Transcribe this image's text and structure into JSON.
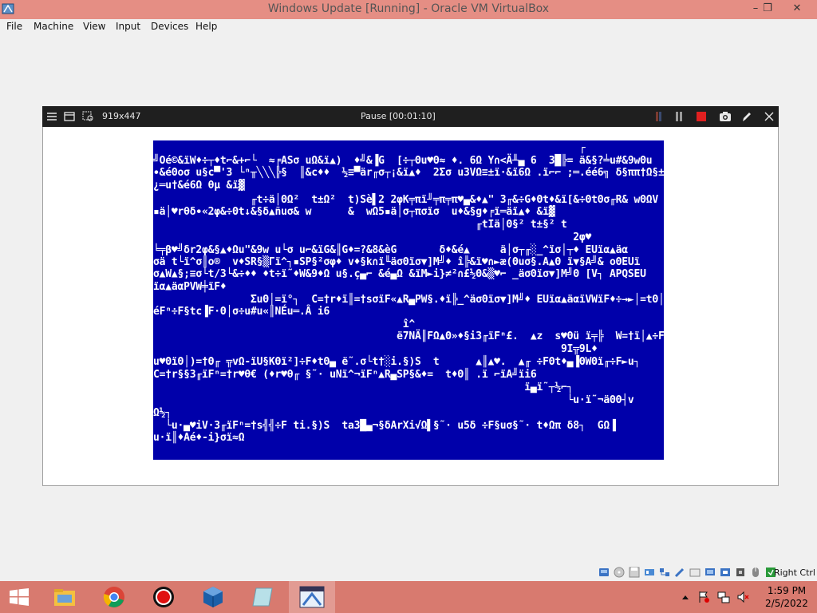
{
  "window": {
    "title": "Windows Update [Running] - Oracle VM VirtualBox",
    "minimize": "–",
    "restore": "❐",
    "close": "✕"
  },
  "menu": {
    "items": [
      "File",
      "Machine",
      "View",
      "Input",
      "Devices",
      "Help"
    ]
  },
  "capture_toolbar": {
    "dimensions": "919x447",
    "status": "Pause [00:01:10]"
  },
  "guest_screen": {
    "lines": [
      "                                                                      ┌",
      "╝Oé©&ïW♦÷┬♦t⌐&+⌐└  ≈╒ASσ uΩ&ï▲)  ♦╝&▐G  [÷┬Θu♥Θ≈ ♦. 6Ω Y∩<Ä╨▄ 6  3█╠= ä&§?╧u#&9wΘu",
      "∙&éΘoσ u§c▀'3 └ⁿ╥╲╲╲╠§  ║&c♦♦  ½≡▀är╓σ┬¡&ï▲♦  2Σσ u3VΩ≡±ï·&ï6Ω .ï⌐⌐ ;═.éé6╗ δ§ππ†Ω§±&ï⌐Ω",
      "¿═u†&é6Ω θµ &ï▓",
      "                ╓t÷ä│ΘΩ²  t±Ω²  t)Sè▌2 2φK╤πï╜╤π╤π♥▄&♦▲\" 3╓&÷G♦Θt♦&ï[&÷ΘtΘσ╓R& wΘΩV",
      "▪ä│♥rθδ∙«2φ&÷Θt↓&§δ▲ñuσ& w      &  wΩ5▪ä│σ┬πσïσ  u♦&§g♦╒ï═äï▲♦ &ï▓",
      "                                                     ╓tIä│Θ§² t±§² t",
      "                                                                     2φ♥",
      "╘╤β♥╝δr2φ&§▲♦Ωu\"&9w u└σ u⌐&ïG&║G♦=?&8&èG       δ♦&é▲     ä│σ┬╓░_^ïσ│┬♦ EUïα▲äα",
      "σä t└ï^σ║ο®  v♦SR§▒Γï^┐▪SP§²σφ♦ v♦§k∩ï╙äσΘïσ▼]M╝♦ î╠&ï♥∩►æ(Θuσ§.A▲Θ ï▼§A╝& oΘEUï",
      "σ▲W▲§;≡σ└t/3└&÷♦♦ ♦t÷ï˜♦W&9♦Ω u§.ç▄⌐ &é▄Ω &ïM►i}≠²∩£½Θ&▒♥⌐ _äσΘïσ▼]M╝Θ [V┐ APQSEU",
      "ïα▲äαPVW╪ïF♦",
      "                ΣuΘ│=ï°┐  C=†r♦ï║=†sσïF«▲R▄PW§.♦ï╠_^äσΘïσ▼]M╝♦ EUïα▲äαïVWïF♦÷→►│=tΘ│(",
      "éFⁿ÷F§tc▐F·Θ│σ÷u#u«║NÉu═.Â i6",
      "                                         î^",
      "                                        ë7NÄ║FΩ▲Θ»♦§i3╓ïFⁿ£.  ▲z  s♥Θü ï╤╠  W=†ï│▲÷F♦t",
      "                                                                   9I╦9L♦",
      "u♥ΘïΘ│)=†Θ╓ ╦vΩ-ïU§KΘï²]÷F♦tΘ▄ ë˜.σ└t†░i.§)S  t      ▲║▲♥.  ▲╓ ÷FΘt♦▄▐ΘWΘï╓÷F►u┐",
      "C=†r§§3╓ïFⁿ=†r♥θ€ (♦r♥θ╓ §˜· uNï^¬ïFⁿ▲R▄SP§&♦=  t♦Θ║ .ï ⌐ïA╝ïi6",
      "                                                             ï▄ï˜┬½⌐┐",
      "                                                                    └u·ï˜¬äΘΘ┤v",
      "Ω½┐",
      "  └u·▄♥iV·3╓ïFⁿ=†s╣╣÷F ti.§)S  ta3█▄¬§δArXi√Ω▌§˜· u5δ ÷F§uσ§˜· t♦Ωπ δ8┐  GΩ▐",
      "u·ï║♦Aé♦-i}σï≈Ω"
    ]
  },
  "statusbar": {
    "host_key": "Right Ctrl"
  },
  "taskbar": {
    "time": "1:59 PM",
    "date": "2/5/2022"
  },
  "colors": {
    "titlebar": "#e58e84",
    "taskbar": "#d87a6f",
    "guest_bg": "#0000aa"
  }
}
